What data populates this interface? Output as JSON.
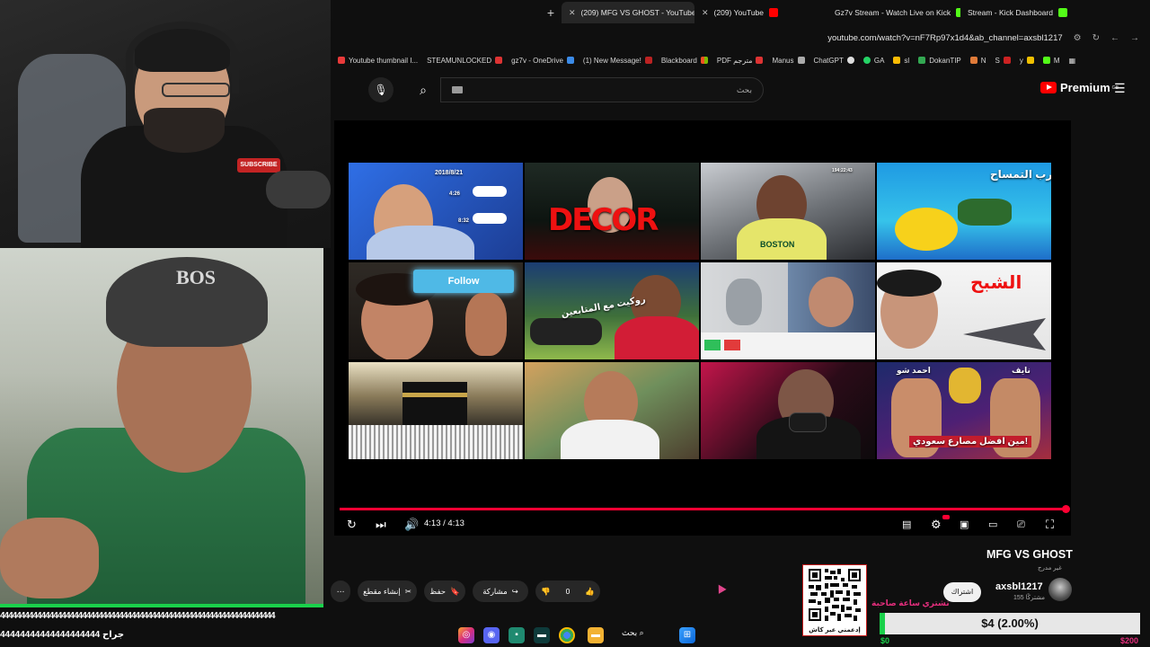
{
  "browser": {
    "tabs": [
      {
        "label": "(209) MFG VS GHOST - YouTube",
        "active": true,
        "favicon": "youtube-icon"
      },
      {
        "label": "(209) YouTube",
        "active": false,
        "favicon": "youtube-icon"
      },
      {
        "label": "Gz7v Stream - Watch Live on Kick",
        "active": false,
        "favicon": "kick-icon"
      },
      {
        "label": "Stream - Kick Dashboard",
        "active": false,
        "favicon": "kick-icon"
      }
    ],
    "url": "youtube.com/watch?v=nF7Rp97x1d4&ab_channel=axsbl1217",
    "bookmarks": [
      "Youtube thumbnail I...",
      "STEAMUNLOCKED",
      "gz7v - OneDrive",
      "(1) New Message!",
      "Blackboard",
      "PDF مترجم",
      "Manus",
      "ChatGPT",
      "GA",
      "sl",
      "DokanTIP",
      "N",
      "S",
      "y",
      "M"
    ]
  },
  "youtube": {
    "search_placeholder": "بحث",
    "logo_text": "Premium",
    "logo_country": "GB",
    "thumbnails": [
      {
        "name": "thumb-1",
        "labels": [
          "2018/8/21",
          "4:26",
          "8:32"
        ]
      },
      {
        "name": "thumb-2",
        "labels": [
          "DECOR"
        ]
      },
      {
        "name": "thumb-3",
        "labels": [
          "BOSTON",
          "194:22:43"
        ]
      },
      {
        "name": "thumb-4",
        "labels": [
          "قارب التمساح"
        ]
      },
      {
        "name": "thumb-5",
        "labels": [
          "Follow"
        ]
      },
      {
        "name": "thumb-6",
        "labels": [
          "روكيت مع المتابعين"
        ]
      },
      {
        "name": "thumb-7",
        "labels": []
      },
      {
        "name": "thumb-8",
        "labels": [
          "الشبح"
        ]
      },
      {
        "name": "thumb-9",
        "labels": []
      },
      {
        "name": "thumb-10",
        "labels": []
      },
      {
        "name": "thumb-11",
        "labels": []
      },
      {
        "name": "thumb-12",
        "labels": [
          "احمد شو",
          "نايف",
          "مين افضل مصارع سعودي!"
        ]
      }
    ],
    "player": {
      "time": "4:13 / 4:13",
      "progress": 1.0
    },
    "video": {
      "title": "MFG VS GHOST",
      "views": "غير مدرج",
      "channel": "axsbl1217",
      "subscribers": "155 مشتركًا",
      "subscribe_label": "اشتراك",
      "like_count": "0",
      "share_label": "مشاركة",
      "save_label": "حفظ",
      "clip_label": "إنشاء مقطع"
    }
  },
  "overlay": {
    "qr_caption": "إدعمني عبر كاش",
    "promo": "تشتري ساعة صاحبة",
    "goal_text": "$4 (2.00%)",
    "goal_fraction": 0.02,
    "goal_min": "$0",
    "goal_max": "$200",
    "ticker": "4444444444444444444444444444444444444444444444444444444444444444444",
    "ticker2": "44444444444444444444 جراح"
  },
  "taskbar": {
    "search_label": "بحث"
  },
  "colors": {
    "yt_red": "#ff0033",
    "kick_green": "#1ad14b",
    "promo_pink": "#e52e7d"
  }
}
